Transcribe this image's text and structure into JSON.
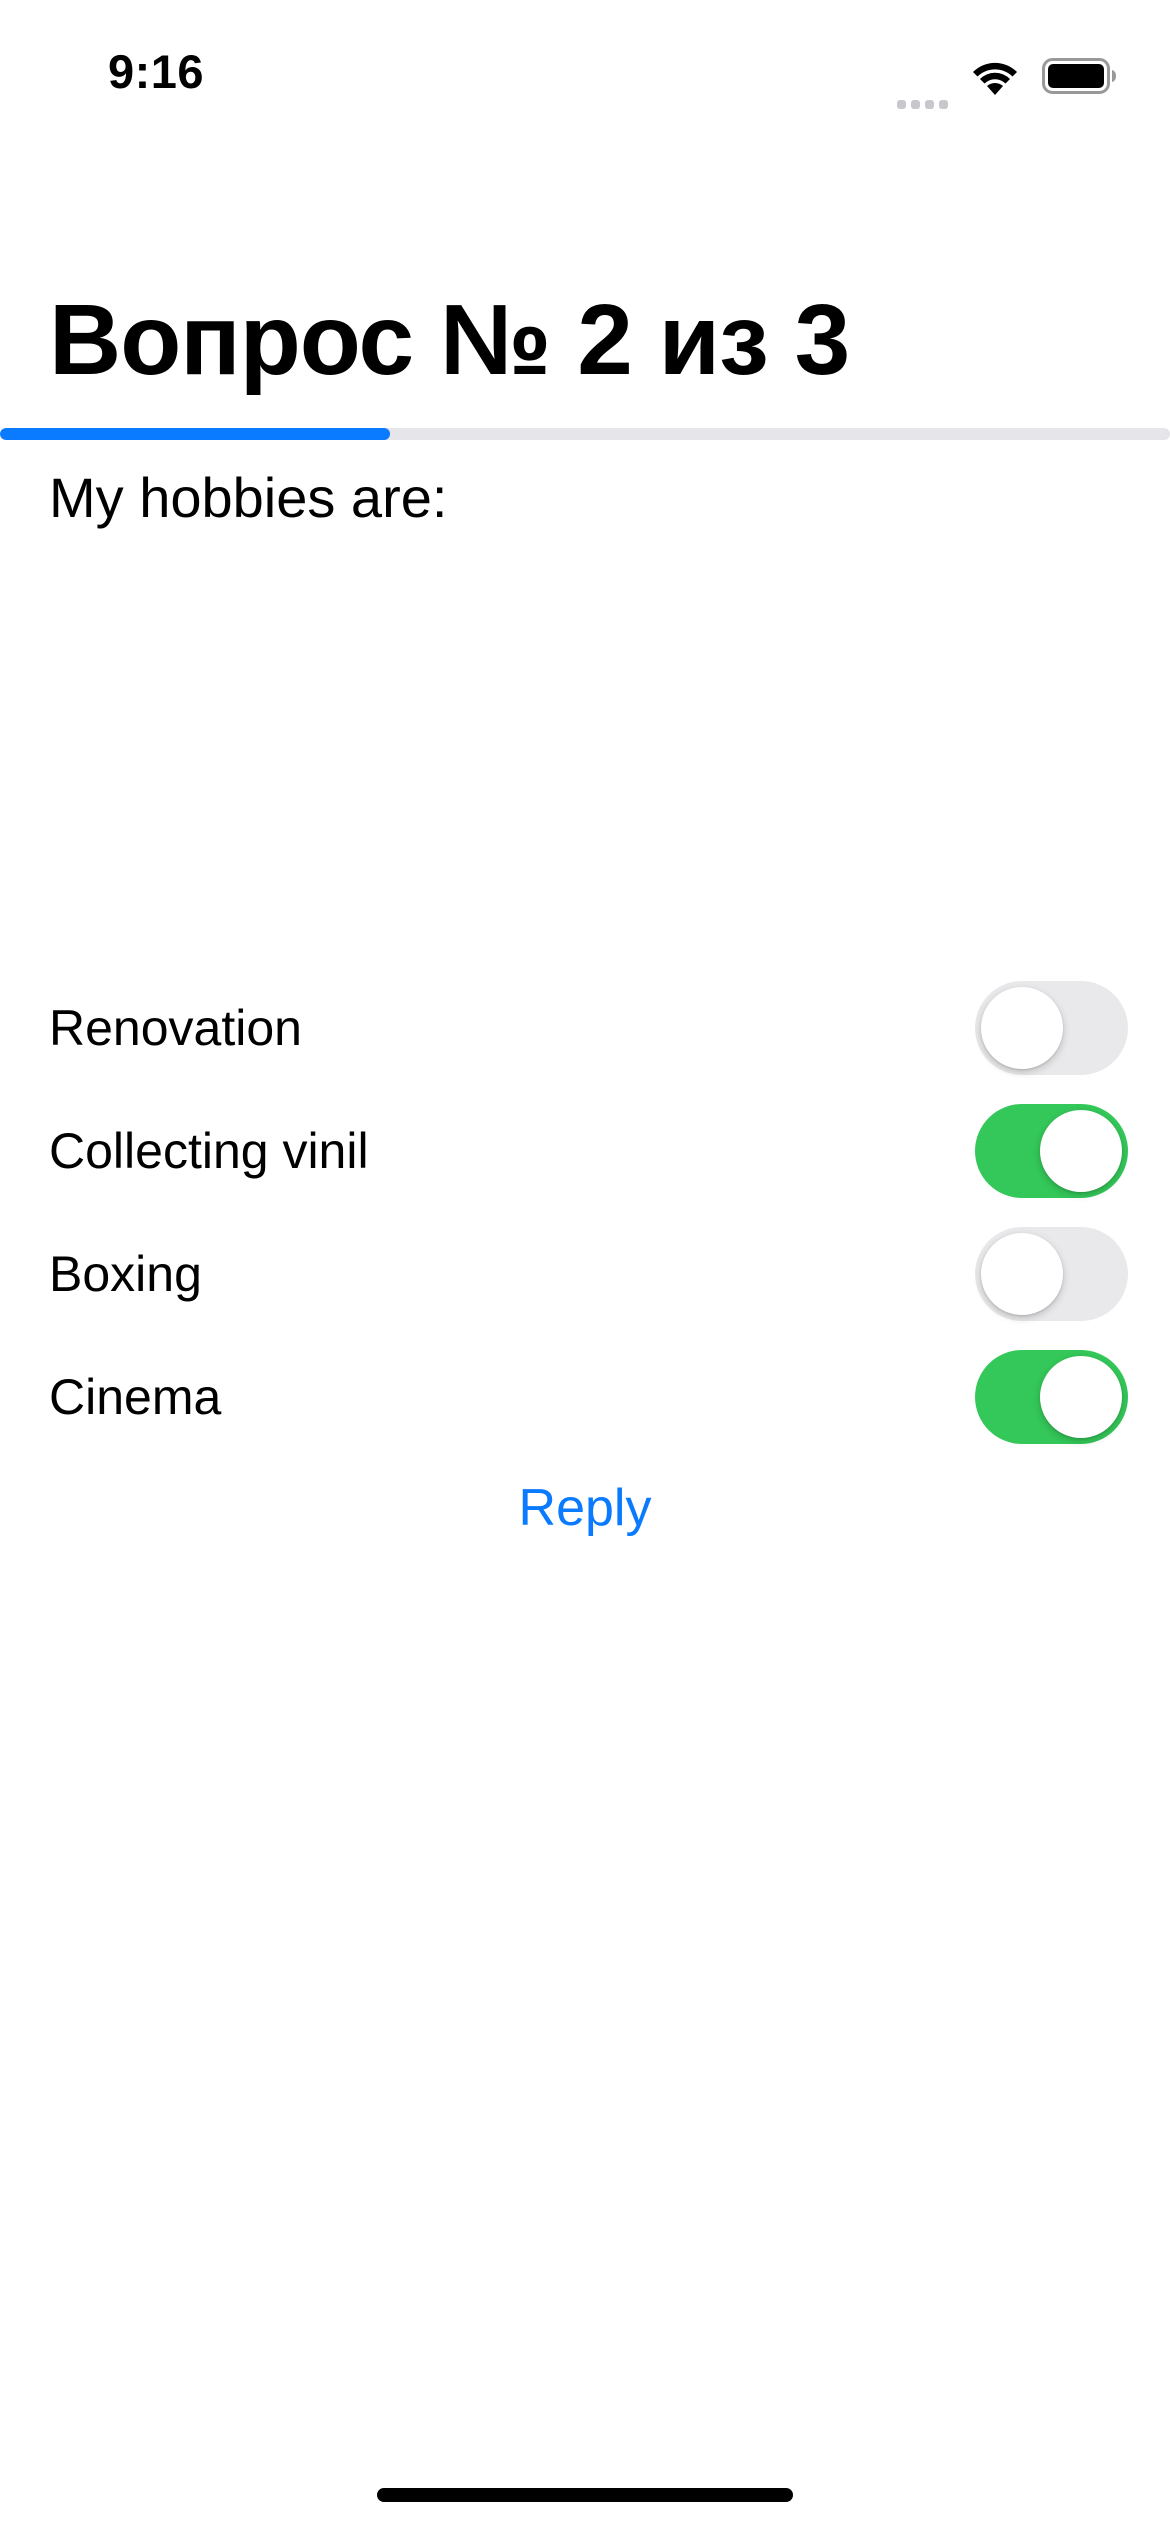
{
  "status_bar": {
    "time": "9:16",
    "icons": [
      "signal-icon",
      "wifi-icon",
      "battery-icon"
    ]
  },
  "title": "Вопрос № 2 из 3",
  "progress": {
    "value": 0.333,
    "color": "#0a7aff",
    "track_color": "#e5e5ea"
  },
  "question": "My hobbies are:",
  "options": [
    {
      "label": "Renovation",
      "enabled": false
    },
    {
      "label": "Collecting vinil",
      "enabled": true
    },
    {
      "label": "Boxing",
      "enabled": false
    },
    {
      "label": "Cinema",
      "enabled": true
    }
  ],
  "reply_label": "Reply",
  "colors": {
    "accent": "#0a7aff",
    "toggle_on": "#34c759",
    "toggle_off": "#e9e9eb"
  }
}
